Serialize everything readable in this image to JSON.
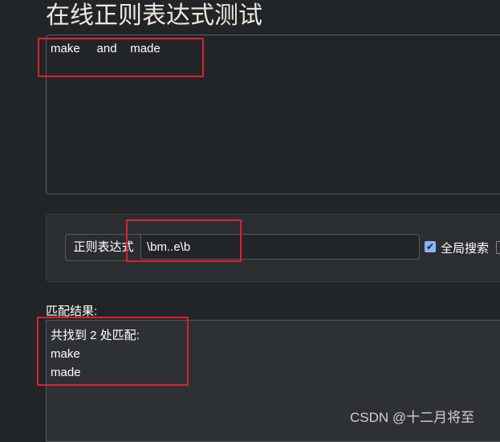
{
  "title": "在线正则表达式测试",
  "source_text": "make     and    made",
  "regex": {
    "label": "正则表达式",
    "value": "\\bm..e\\b"
  },
  "options": {
    "global_label": "全局搜索",
    "global_checked": true
  },
  "result": {
    "label": "匹配结果:",
    "summary": "共找到 2 处匹配:",
    "matches": [
      "make",
      "made"
    ]
  },
  "watermark": "CSDN @十二月将至",
  "colors": {
    "highlight_box": "#e0202a",
    "background": "#222528"
  }
}
